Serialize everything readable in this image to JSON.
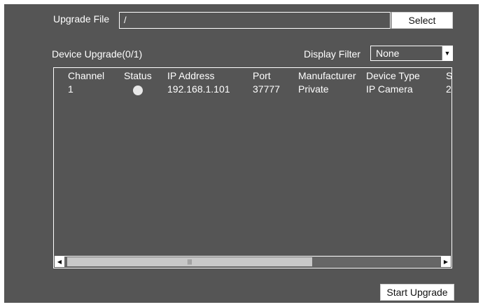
{
  "upgrade_file": {
    "label": "Upgrade File",
    "value": "/",
    "select_label": "Select"
  },
  "device_upgrade": {
    "title": "Device Upgrade(0/1)",
    "filter_label": "Display Filter",
    "filter_value": "None"
  },
  "table": {
    "columns": [
      "Channel",
      "Status",
      "IP Address",
      "Port",
      "Manufacturer",
      "Device Type",
      "S"
    ],
    "rows": [
      {
        "channel": "1",
        "status": "idle",
        "ip": "192.168.1.101",
        "port": "37777",
        "manufacturer": "Private",
        "device_type": "IP Camera",
        "s": "2"
      }
    ],
    "scroll_fraction": 0.66
  },
  "footer": {
    "start_label": "Start Upgrade"
  },
  "colors": {
    "panel_bg": "#555555",
    "text": "#ffffff",
    "status_idle": "#e8e8e8"
  },
  "icons": {
    "filter_arrow": "chevron-down-icon",
    "scroll_left": "arrow-left-icon",
    "scroll_right": "arrow-right-icon",
    "status": "status-dot-icon"
  }
}
